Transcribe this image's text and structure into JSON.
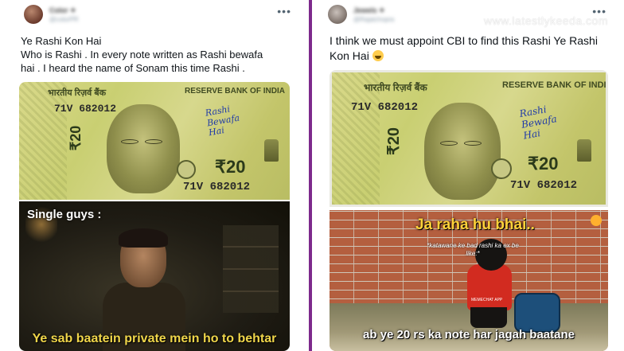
{
  "colors": {
    "divider": "#7d2a8c",
    "text": "#0f1419",
    "meme_yellow": "#f0d64a"
  },
  "left_tweet": {
    "more_icon": "more-horizontal-icon",
    "text_lines": [
      "Ye Rashi Kon Hai",
      "Who is Rashi . In every note written as Rashi bewafa",
      "hai . I heard the name of Sonam this time Rashi ."
    ],
    "note": {
      "hindi_header": "भारतीय रिज़र्व बैंक",
      "english_header": "RESERVE BANK OF INDIA",
      "serial": "71V 682012",
      "denomination": "₹20",
      "side_value": "₹20",
      "handwriting": [
        "Rashi",
        "Bewafa",
        "Hai"
      ]
    },
    "meme": {
      "top_caption": "Single guys :",
      "bottom_caption": "Ye sab baatein private mein ho to behtar"
    }
  },
  "right_tweet": {
    "more_icon": "more-horizontal-icon",
    "watermark": "www.latestlykeeda.com",
    "text": "I think we must appoint CBI to find this Rashi Ye Rashi Kon Hai",
    "emoji": "tears-of-joy-emoji",
    "note": {
      "hindi_header": "भारतीय रिज़र्व बैंक",
      "english_header": "RESERVE BANK OF INDIA",
      "serial": "71V 682012",
      "denomination": "₹20",
      "side_value": "₹20",
      "handwriting": [
        "Rashi",
        "Bewafa",
        "Hai"
      ]
    },
    "meme": {
      "title": "Ja raha hu bhai..",
      "subtitle": "*katawane ke bad rashi ka ex be like:*",
      "brand": "MEMECHAT APP",
      "caption": "ab ye 20 rs ka note har jagah baatane"
    }
  }
}
